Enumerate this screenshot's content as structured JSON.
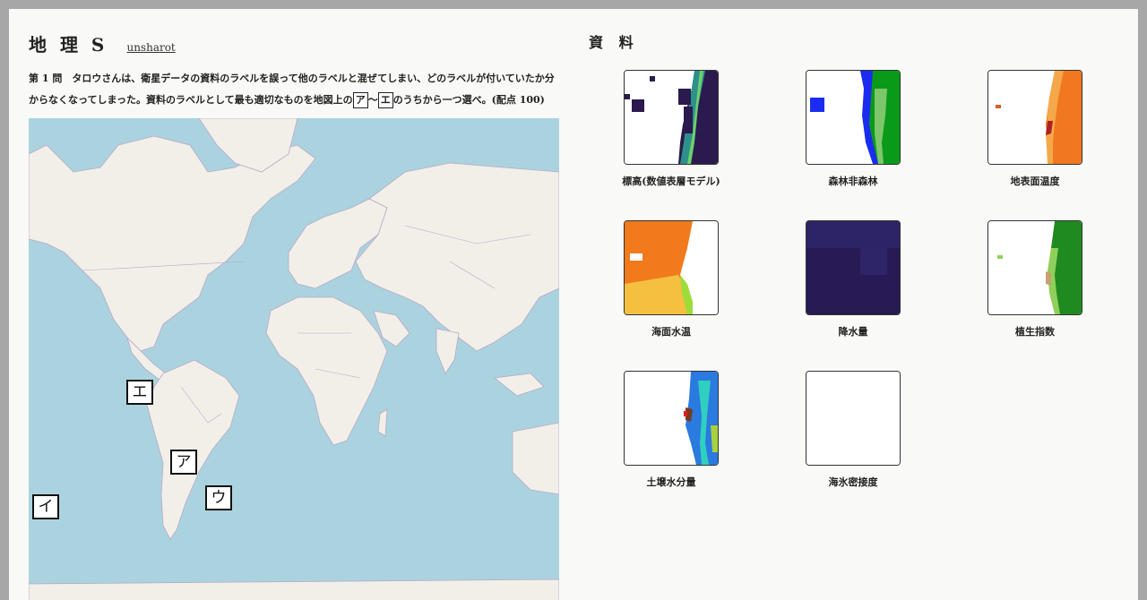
{
  "header": {
    "title": "地 理 S",
    "author": "unsharot"
  },
  "question": {
    "line1": "第 1 問　タロウさんは、衛星データの資料のラベルを誤って他のラベルと混ぜてしまい、どのラベルが付いていたか分",
    "line2a": "からなくなってしまった。資料のラベルとして最も適切なものを地図上の",
    "box_start": "ア",
    "tilde": "～",
    "box_end": "エ",
    "line2b": "のうちから一つ選べ。(配点 100)"
  },
  "map": {
    "markers": {
      "a": "ア",
      "i": "イ",
      "u": "ウ",
      "e": "エ"
    }
  },
  "materials": {
    "title": "資 料",
    "items": [
      {
        "caption": "標高(数値表層モデル)"
      },
      {
        "caption": "森林非森林"
      },
      {
        "caption": "地表面温度"
      },
      {
        "caption": "海面水温"
      },
      {
        "caption": "降水量"
      },
      {
        "caption": "植生指数"
      },
      {
        "caption": "土壌水分量"
      },
      {
        "caption": "海氷密接度"
      }
    ]
  },
  "colors": {
    "ocean": "#aad3df",
    "land": "#f2efe9",
    "border": "#b9a8c6"
  }
}
